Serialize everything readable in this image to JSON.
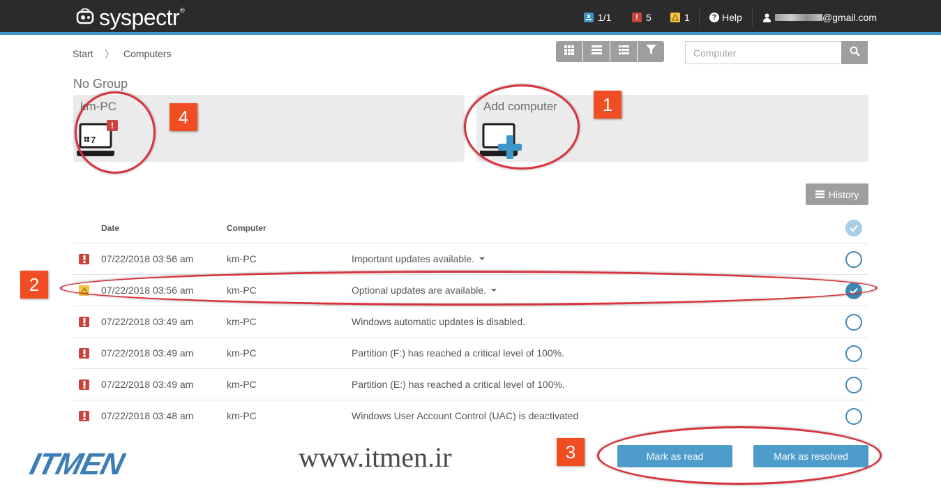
{
  "header": {
    "brand": "syspectr",
    "brand_mark": "®",
    "stats": {
      "computers": "1/1",
      "critical": "5",
      "warnings": "1"
    },
    "help_label": "Help",
    "user_email_suffix": "@gmail.com"
  },
  "breadcrumb": {
    "start": "Start",
    "separator": "〉",
    "current": "Computers"
  },
  "toolbar": {
    "view_buttons": [
      "grid-view-icon",
      "list-view-icon",
      "detail-list-icon",
      "filter-icon"
    ],
    "search_placeholder": "Computer"
  },
  "groups": {
    "title": "No Group",
    "tiles": [
      {
        "label": "km-PC",
        "icon": "windows-7-laptop-icon",
        "alert": "!"
      },
      {
        "label": "Add computer",
        "icon": "add-computer-icon"
      }
    ]
  },
  "history": {
    "label": "History"
  },
  "table": {
    "columns": {
      "date": "Date",
      "computer": "Computer"
    },
    "rows": [
      {
        "severity": "critical",
        "date": "07/22/2018 03:56 am",
        "computer": "km-PC",
        "message": "Important updates available.",
        "expandable": true,
        "checked": false
      },
      {
        "severity": "warning",
        "date": "07/22/2018 03:56 am",
        "computer": "km-PC",
        "message": "Optional updates are available.",
        "expandable": true,
        "checked": true
      },
      {
        "severity": "critical",
        "date": "07/22/2018 03:49 am",
        "computer": "km-PC",
        "message": "Windows automatic updates is disabled.",
        "expandable": false,
        "checked": false
      },
      {
        "severity": "critical",
        "date": "07/22/2018 03:49 am",
        "computer": "km-PC",
        "message": "Partition (F:) has reached a critical level of 100%.",
        "expandable": false,
        "checked": false
      },
      {
        "severity": "critical",
        "date": "07/22/2018 03:49 am",
        "computer": "km-PC",
        "message": "Partition (E:) has reached a critical level of 100%.",
        "expandable": false,
        "checked": false
      },
      {
        "severity": "critical",
        "date": "07/22/2018 03:48 am",
        "computer": "km-PC",
        "message": "Windows User Account Control (UAC) is deactivated",
        "expandable": false,
        "checked": false
      }
    ]
  },
  "actions": {
    "mark_read": "Mark as read",
    "mark_resolved": "Mark as resolved"
  },
  "annotations": [
    "1",
    "2",
    "3",
    "4"
  ],
  "watermark": {
    "logo": "ITMEN",
    "url": "www.itmen.ir"
  },
  "colors": {
    "header_bg": "#2b2b2b",
    "accent": "#3f97c9",
    "critical": "#c8443d",
    "warning": "#f4c541",
    "button_gray": "#9e9e9e",
    "action_blue": "#4d9cca",
    "annotation_ring": "#d8323a",
    "annotation_badge": "#f04d23"
  }
}
